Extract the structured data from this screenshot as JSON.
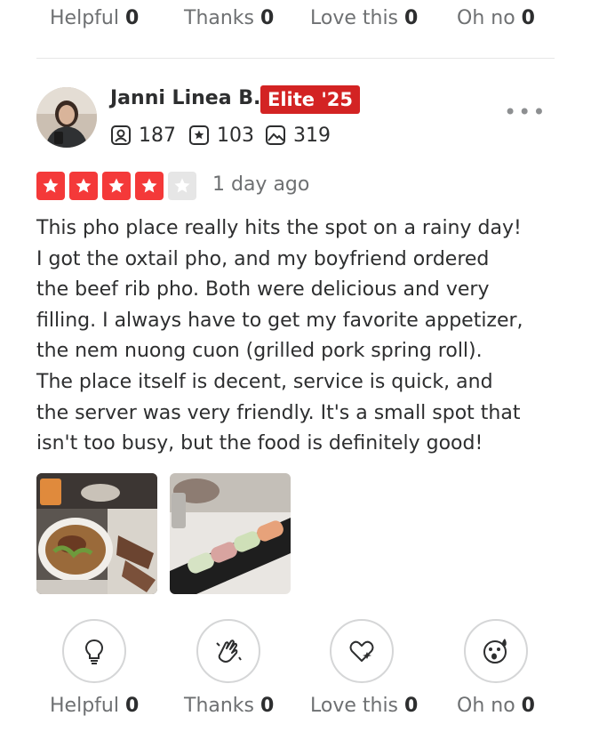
{
  "top_reactions": [
    {
      "label": "Helpful",
      "count": "0"
    },
    {
      "label": "Thanks",
      "count": "0"
    },
    {
      "label": "Love this",
      "count": "0"
    },
    {
      "label": "Oh no",
      "count": "0"
    }
  ],
  "review": {
    "user_name": "Janni Linea B.",
    "elite_badge": "Elite '25",
    "stats": {
      "friends": "187",
      "reviews": "103",
      "photos": "319"
    },
    "rating": 4,
    "rating_max": 5,
    "date": "1 day ago",
    "text_lines": [
      "This pho place really hits the spot on a rainy day!",
      "I got the oxtail pho, and my boyfriend ordered",
      "the beef rib pho. Both were delicious and very",
      "filling. I always have to get my favorite appetizer,",
      "the nem nuong cuon (grilled pork spring roll).",
      "The place itself is decent, service is quick, and",
      "the server was very friendly. It's a small spot that",
      "isn't too busy, but the food is definitely good!"
    ],
    "photos": [
      {
        "subject": "oxtail-pho-bowl-photo"
      },
      {
        "subject": "spring-rolls-photo"
      }
    ]
  },
  "bottom_reactions": [
    {
      "label": "Helpful",
      "count": "0",
      "icon": "lightbulb-icon"
    },
    {
      "label": "Thanks",
      "count": "0",
      "icon": "clapping-hands-icon"
    },
    {
      "label": "Love this",
      "count": "0",
      "icon": "heart-sparkle-icon"
    },
    {
      "label": "Oh no",
      "count": "0",
      "icon": "surprised-face-icon"
    }
  ],
  "colors": {
    "star_filled": "#f43939",
    "star_empty": "#e6e6e6",
    "elite_badge": "#d32323",
    "muted_text": "#6e7072"
  }
}
